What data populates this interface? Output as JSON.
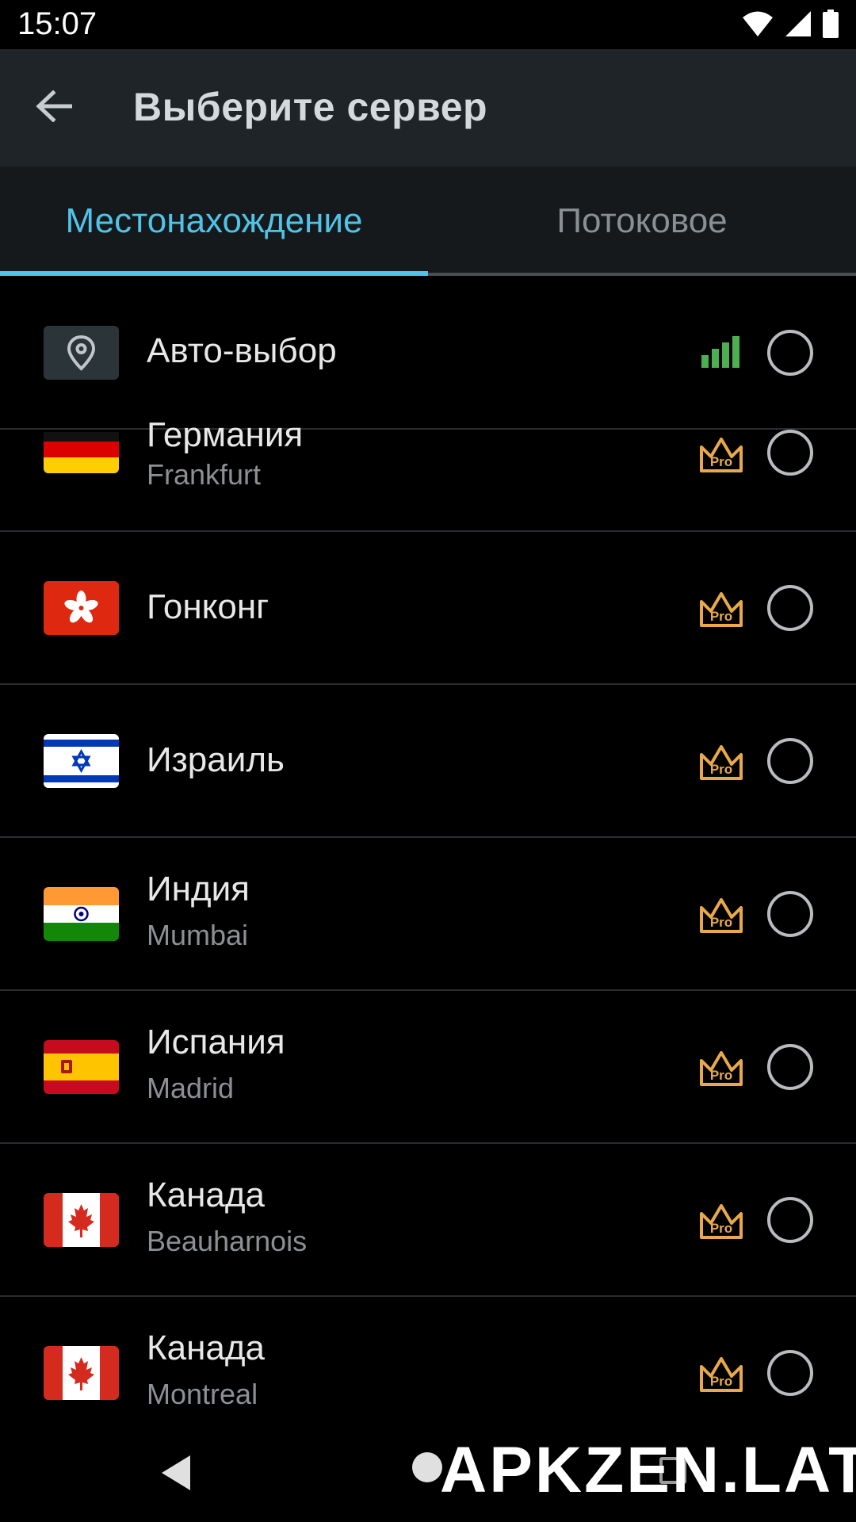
{
  "status_bar": {
    "time": "15:07"
  },
  "app_bar": {
    "title": "Выберите сервер",
    "back_icon": "arrow-back-icon"
  },
  "tabs": [
    {
      "label": "Местонахождение",
      "selected": true
    },
    {
      "label": "Потоковое",
      "selected": false
    }
  ],
  "servers": [
    {
      "title": "Авто-выбор",
      "subtitle": "",
      "icon": "location-pin-icon",
      "badge": "signal-bars-icon",
      "selected": false
    },
    {
      "title": "Германия",
      "subtitle": "Frankfurt",
      "icon": "germany-flag-icon",
      "badge": "Pro",
      "selected": false
    },
    {
      "title": "Гонконг",
      "subtitle": "",
      "icon": "hong-kong-flag-icon",
      "badge": "Pro",
      "selected": false
    },
    {
      "title": "Израиль",
      "subtitle": "",
      "icon": "israel-flag-icon",
      "badge": "Pro",
      "selected": false
    },
    {
      "title": "Индия",
      "subtitle": "Mumbai",
      "icon": "india-flag-icon",
      "badge": "Pro",
      "selected": false
    },
    {
      "title": "Испания",
      "subtitle": "Madrid",
      "icon": "spain-flag-icon",
      "badge": "Pro",
      "selected": false
    },
    {
      "title": "Канада",
      "subtitle": "Beauharnois",
      "icon": "canada-flag-icon",
      "badge": "Pro",
      "selected": false
    },
    {
      "title": "Канада",
      "subtitle": "Montreal",
      "icon": "canada-flag-icon",
      "badge": "Pro",
      "selected": false
    }
  ],
  "colors": {
    "accent": "#4fc3e8",
    "pro_gold": "#e9a94a",
    "signal_green": "#4caf50"
  },
  "watermark": "APKZEN.LAT"
}
